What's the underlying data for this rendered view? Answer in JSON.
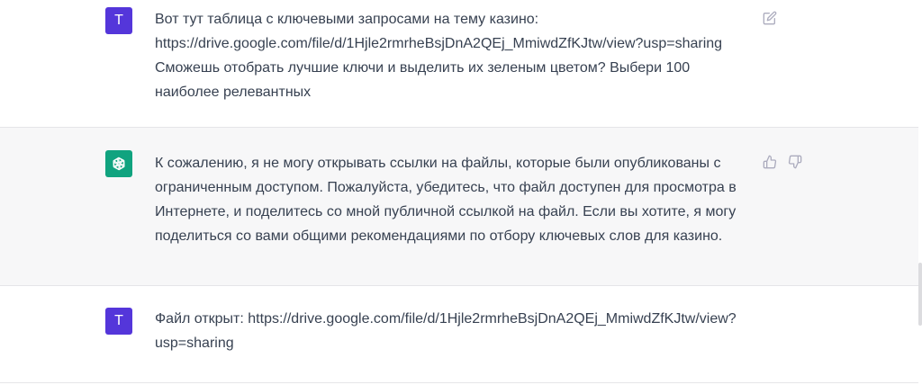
{
  "messages": [
    {
      "role": "user",
      "avatar_letter": "T",
      "lines": [
        "Вот тут таблица с ключевыми запросами на тему казино:",
        "https://drive.google.com/file/d/1Hjle2rmrheBsjDnA2QEj_MmiwdZfKJtw/view?usp=sharing",
        "Сможешь отобрать лучшие ключи и выделить их зеленым цветом? Выбери 100",
        "наиболее релевантных"
      ],
      "action_icon": "edit-icon"
    },
    {
      "role": "assistant",
      "avatar_icon": "openai-logo-icon",
      "lines": [
        "К сожалению, я не могу открывать ссылки на файлы, которые были опубликованы с",
        "ограниченным доступом. Пожалуйста, убедитесь, что файл доступен для просмотра в",
        "Интернете, и поделитесь со мной публичной ссылкой на файл. Если вы хотите, я могу",
        "поделиться со вами общими рекомендациями по отбору ключевых слов для казино."
      ],
      "action_icons": [
        "thumbs-up-icon",
        "thumbs-down-icon"
      ]
    },
    {
      "role": "user",
      "avatar_letter": "T",
      "lines": [
        "Файл открыт: https://drive.google.com/file/d/1Hjle2rmrheBsjDnA2QEj_MmiwdZfKJtw/view?",
        "usp=sharing"
      ]
    }
  ],
  "colors": {
    "user_avatar": "#5436da",
    "assistant_avatar": "#10a37f",
    "assistant_bg": "#f7f7f8",
    "text": "#374151",
    "icon": "#acacbe"
  }
}
